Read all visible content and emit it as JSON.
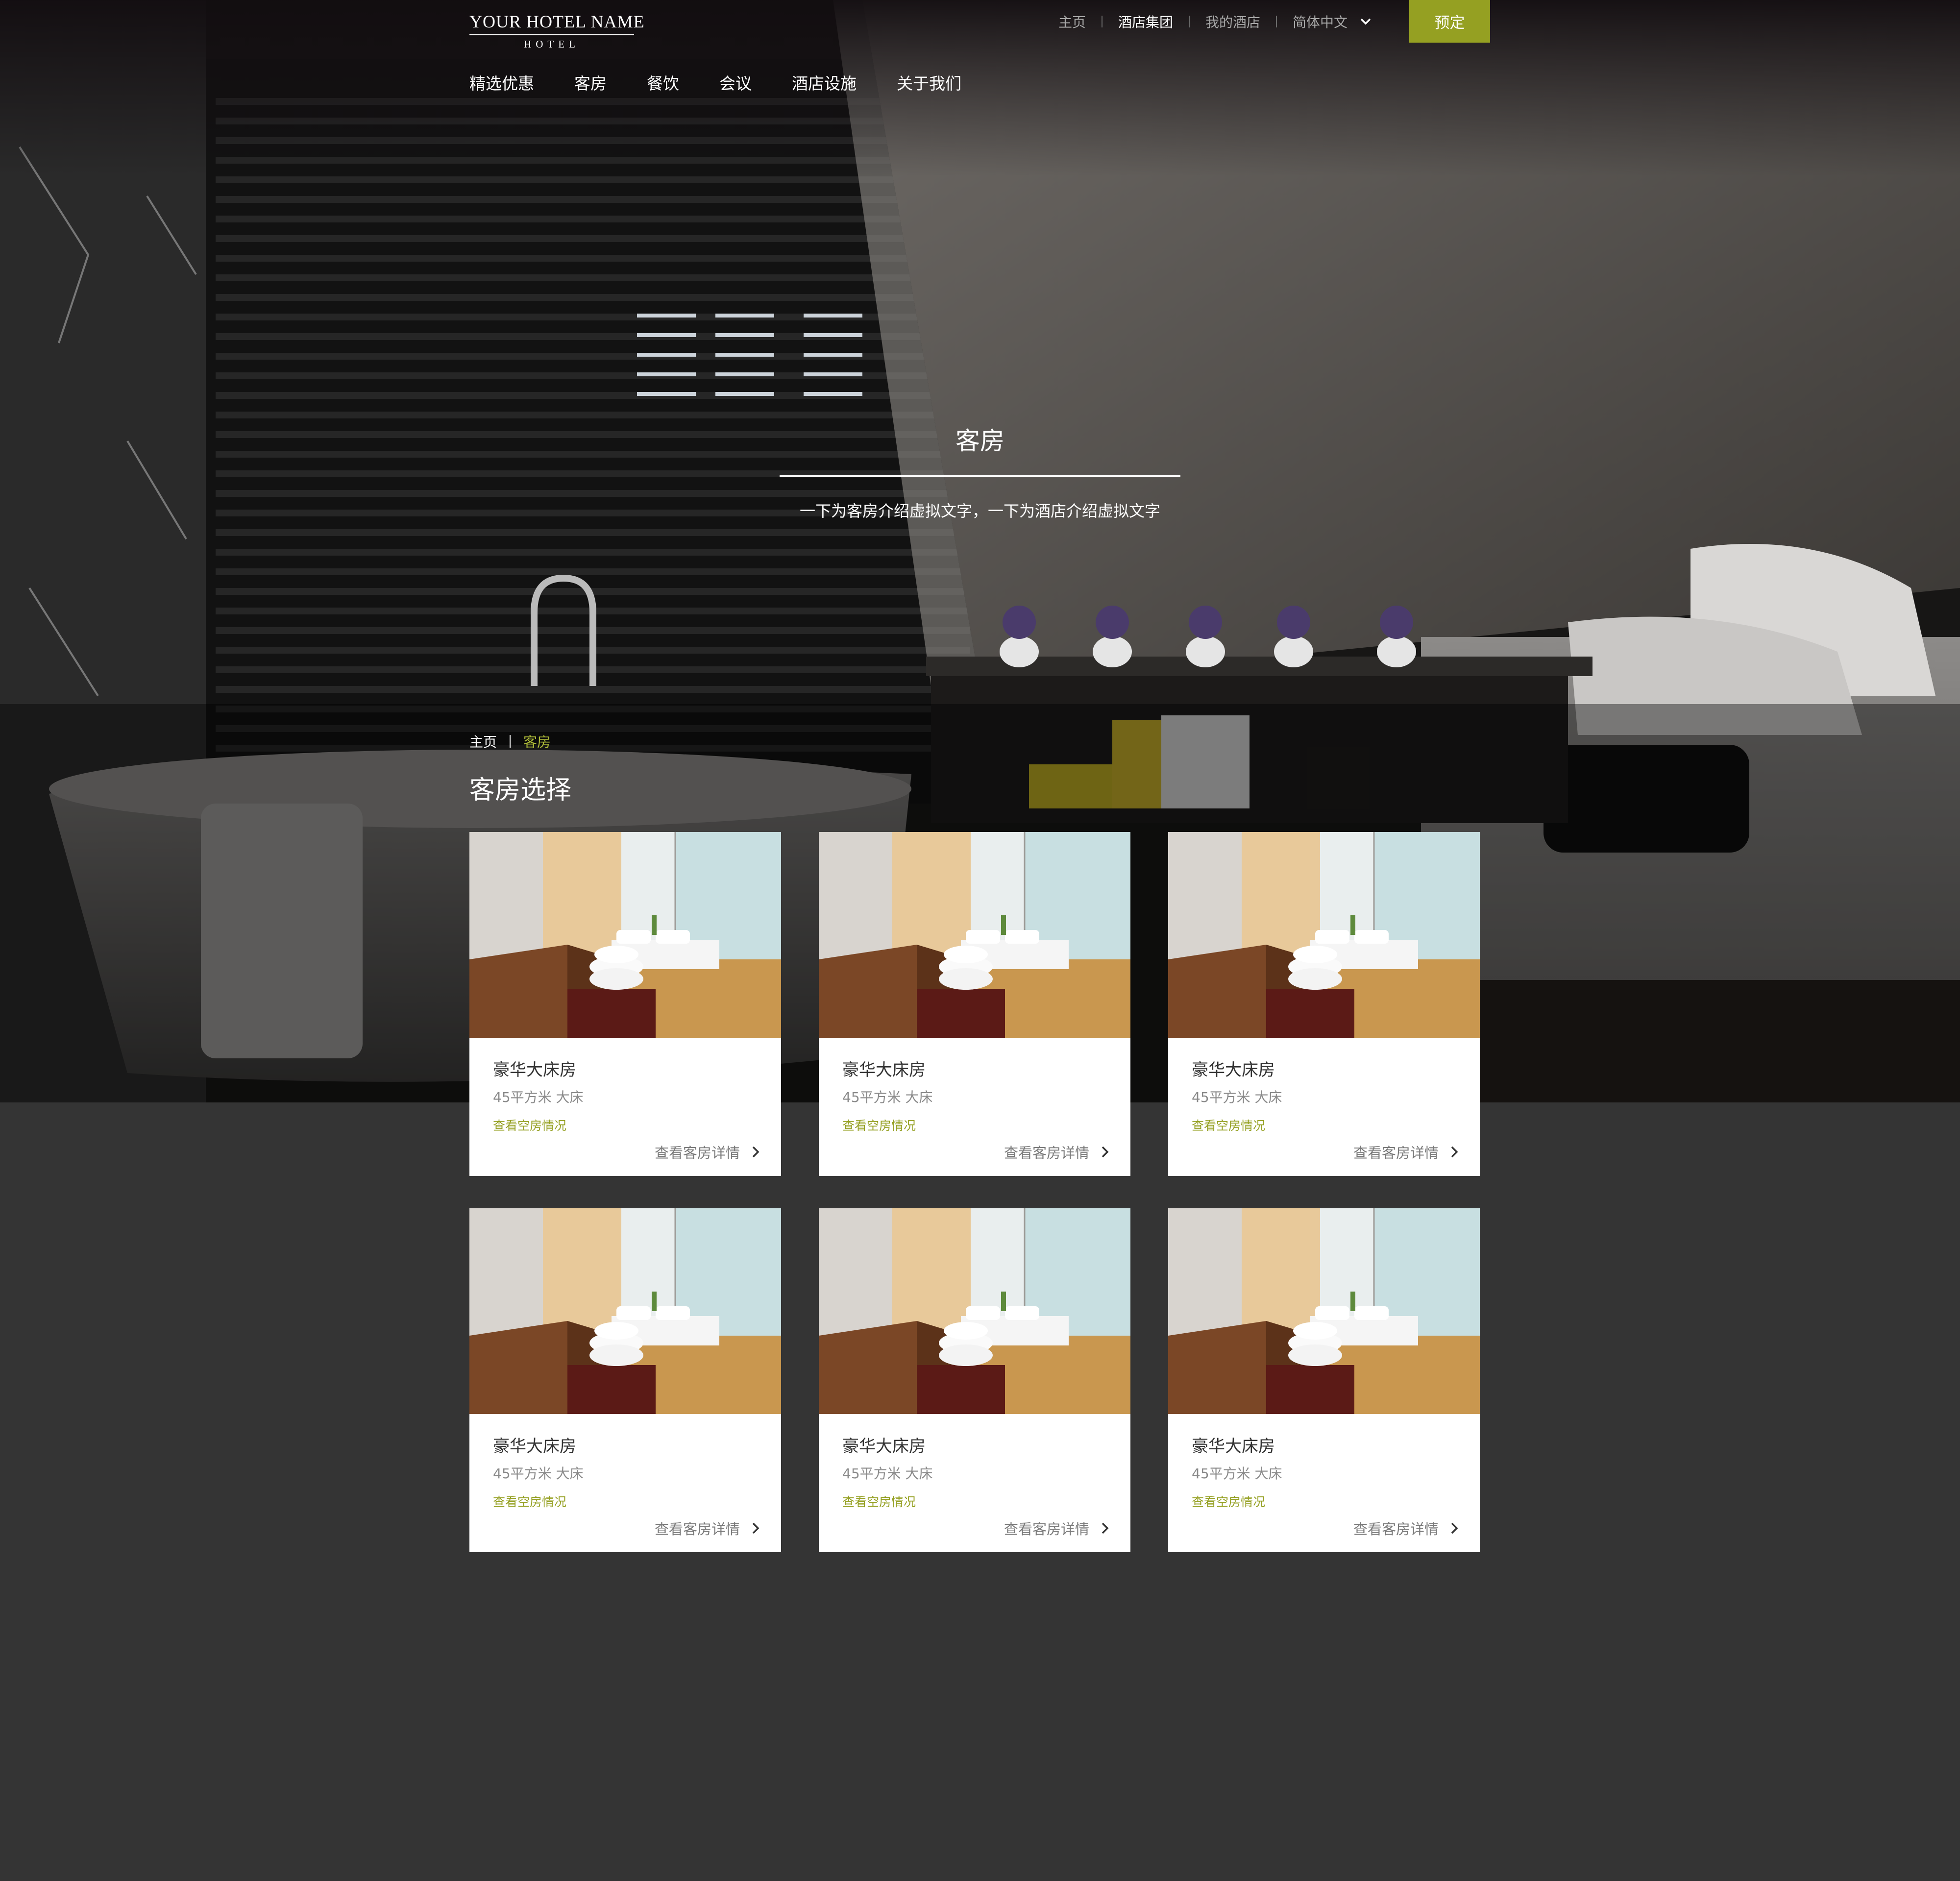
{
  "header": {
    "logo": {
      "name": "YOUR HOTEL NAME",
      "sub": "HOTEL"
    },
    "top_links": {
      "home": "主页",
      "group": "酒店集团",
      "my_hotel": "我的酒店",
      "language": "简体中文"
    },
    "book_button": "预定",
    "main_nav": [
      "精选优惠",
      "客房",
      "餐饮",
      "会议",
      "酒店设施",
      "关于我们"
    ]
  },
  "hero": {
    "title": "客房",
    "subtitle": "一下为客房介绍虚拟文字，一下为酒店介绍虚拟文字"
  },
  "breadcrumb": {
    "home": "主页",
    "current": "客房"
  },
  "section_title": "客房选择",
  "rooms": [
    {
      "name": "豪华大床房",
      "spec": "45平方米   大床",
      "availability": "查看空房情况",
      "details": "查看客房详情"
    },
    {
      "name": "豪华大床房",
      "spec": "45平方米   大床",
      "availability": "查看空房情况",
      "details": "查看客房详情"
    },
    {
      "name": "豪华大床房",
      "spec": "45平方米   大床",
      "availability": "查看空房情况",
      "details": "查看客房详情"
    },
    {
      "name": "豪华大床房",
      "spec": "45平方米   大床",
      "availability": "查看空房情况",
      "details": "查看客房详情"
    },
    {
      "name": "豪华大床房",
      "spec": "45平方米   大床",
      "availability": "查看空房情况",
      "details": "查看客房详情"
    },
    {
      "name": "豪华大床房",
      "spec": "45平方米   大床",
      "availability": "查看空房情况",
      "details": "查看客房详情"
    }
  ],
  "colors": {
    "accent": "#95a022",
    "page_background": "#343434",
    "breadcrumb_current": "#b0bd3a"
  },
  "icons": {
    "language_dropdown": "chevron-down-icon",
    "card_detail": "chevron-right-icon"
  }
}
